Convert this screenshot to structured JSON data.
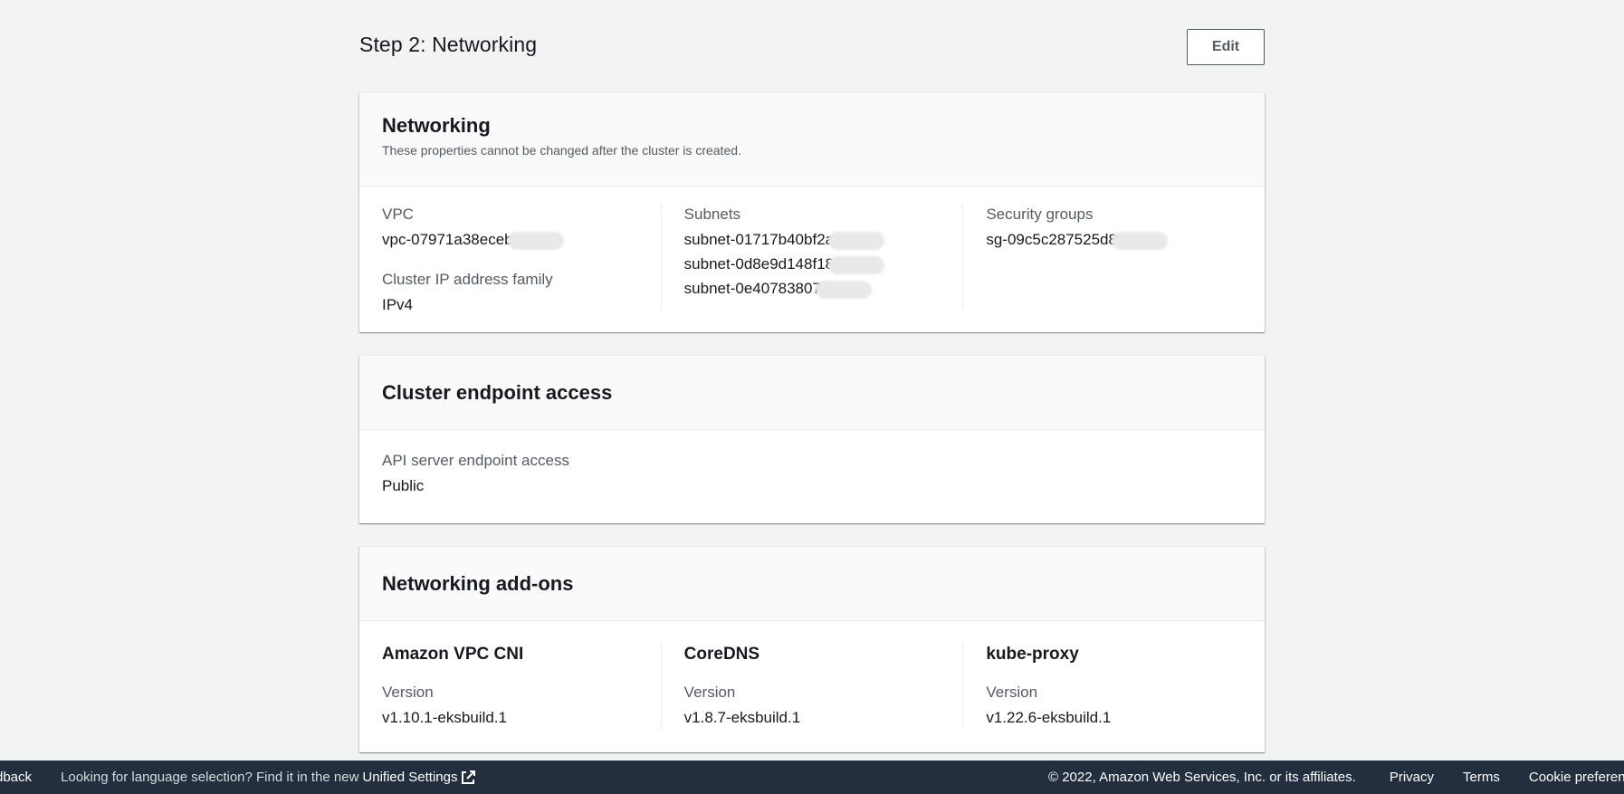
{
  "step": {
    "title": "Step 2: Networking",
    "edit_label": "Edit"
  },
  "networking": {
    "title": "Networking",
    "description": "These properties cannot be changed after the cluster is created.",
    "vpc_label": "VPC",
    "vpc_value": "vpc-07971a38eceb",
    "ip_family_label": "Cluster IP address family",
    "ip_family_value": "IPv4",
    "subnets_label": "Subnets",
    "subnets": [
      "subnet-01717b40bf2a",
      "subnet-0d8e9d148f18",
      "subnet-0e40783807"
    ],
    "sg_label": "Security groups",
    "sg_value": "sg-09c5c287525d8"
  },
  "endpoint": {
    "title": "Cluster endpoint access",
    "api_label": "API server endpoint access",
    "api_value": "Public"
  },
  "addons": {
    "title": "Networking add-ons",
    "items": [
      {
        "name": "Amazon VPC CNI",
        "version_label": "Version",
        "version": "v1.10.1-eksbuild.1"
      },
      {
        "name": "CoreDNS",
        "version_label": "Version",
        "version": "v1.8.7-eksbuild.1"
      },
      {
        "name": "kube-proxy",
        "version_label": "Version",
        "version": "v1.22.6-eksbuild.1"
      }
    ]
  },
  "footer": {
    "feedback": "dback",
    "lang_text": "Looking for language selection? Find it in the new",
    "unified_settings": "Unified Settings",
    "copyright": "© 2022, Amazon Web Services, Inc. or its affiliates.",
    "privacy": "Privacy",
    "terms": "Terms",
    "cookie": "Cookie preferen"
  },
  "colors": {
    "background": "#f2f3f3",
    "footer_bg": "#232f3e",
    "text": "#16191f",
    "secondary_text": "#545b64"
  },
  "icons": {
    "external_link": "external-link-icon"
  }
}
